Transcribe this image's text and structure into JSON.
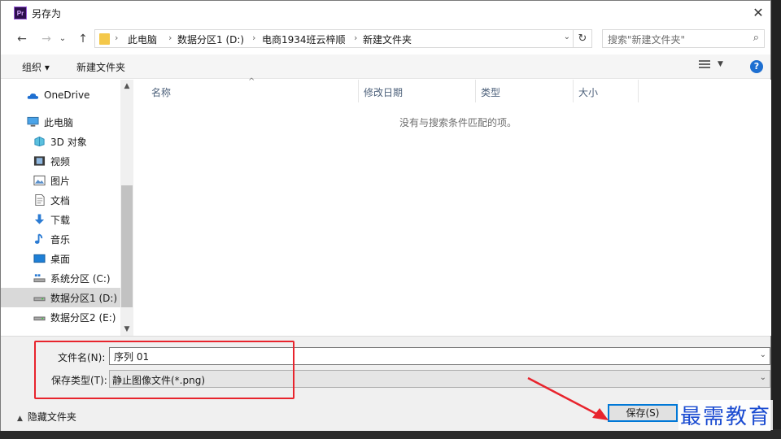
{
  "window": {
    "title": "另存为",
    "app_icon_text": "Pr",
    "close_glyph": "✕"
  },
  "navigation": {
    "back": "←",
    "forward": "→",
    "recent": "⌄",
    "up": "↑"
  },
  "address": {
    "crumbs": [
      "此电脑",
      "数据分区1 (D:)",
      "电商1934班云梓顺",
      "新建文件夹"
    ],
    "separator": "›",
    "dropdown": "⌄",
    "refresh": "↻"
  },
  "search": {
    "placeholder": "搜索\"新建文件夹\"",
    "icon": "⌕"
  },
  "toolbar": {
    "organize": "组织 ▾",
    "new_folder": "新建文件夹",
    "view_dropdown": "▼",
    "help": "?"
  },
  "sidebar": {
    "items": [
      {
        "label": "OneDrive",
        "icon": "cloud-icon"
      },
      {
        "label": "此电脑",
        "icon": "computer-icon"
      },
      {
        "label": "3D 对象",
        "icon": "3d-objects-icon"
      },
      {
        "label": "视频",
        "icon": "video-icon"
      },
      {
        "label": "图片",
        "icon": "pictures-icon"
      },
      {
        "label": "文档",
        "icon": "documents-icon"
      },
      {
        "label": "下载",
        "icon": "download-icon"
      },
      {
        "label": "音乐",
        "icon": "music-icon"
      },
      {
        "label": "桌面",
        "icon": "desktop-icon"
      },
      {
        "label": "系统分区 (C:)",
        "icon": "drive-icon"
      },
      {
        "label": "数据分区1 (D:)",
        "icon": "drive-icon",
        "selected": true
      },
      {
        "label": "数据分区2 (E:)",
        "icon": "drive-icon"
      }
    ]
  },
  "file_list": {
    "columns": [
      "名称",
      "修改日期",
      "类型",
      "大小"
    ],
    "sort_caret": "^",
    "empty_message": "没有与搜索条件匹配的项。"
  },
  "form": {
    "filename_label": "文件名(N):",
    "filename_value": "序列 01",
    "filetype_label": "保存类型(T):",
    "filetype_value": "静止图像文件(*.png)",
    "dropdown_arrow": "⌄"
  },
  "footer": {
    "hide_folders": "隐藏文件夹",
    "hide_caret": "▲",
    "save_button": "保存(S)"
  },
  "watermark": "最需教育",
  "colors": {
    "annotation_red": "#e8242d",
    "accent_blue": "#0078d7",
    "watermark_blue": "#1a4bd1"
  }
}
